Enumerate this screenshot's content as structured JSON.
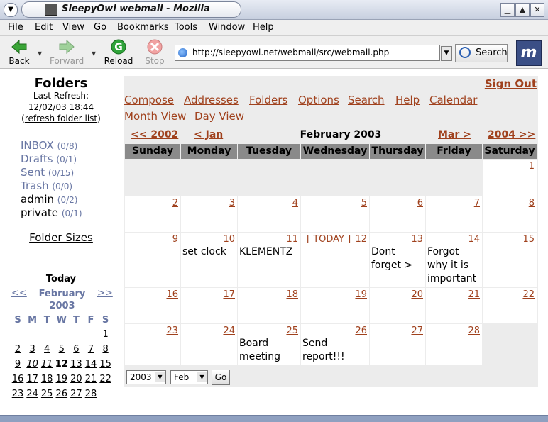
{
  "window": {
    "title": "SleepyOwl webmail - Mozilla"
  },
  "menubar": [
    {
      "label": "File"
    },
    {
      "label": "Edit"
    },
    {
      "label": "View"
    },
    {
      "label": "Go"
    },
    {
      "label": "Bookmarks"
    },
    {
      "label": "Tools"
    },
    {
      "label": "Window"
    },
    {
      "label": "Help"
    }
  ],
  "toolbar": {
    "back": "Back",
    "forward": "Forward",
    "reload": "Reload",
    "stop": "Stop",
    "url": "http://sleepyowl.net/webmail/src/webmail.php",
    "search": "Search"
  },
  "left": {
    "title": "Folders",
    "last_refresh_label": "Last Refresh:",
    "last_refresh_value": "12/02/03 18:44",
    "refresh_link": "refresh folder list",
    "folders": [
      {
        "name": "INBOX",
        "count": "(0/8)"
      },
      {
        "name": "Drafts",
        "count": "(0/1)"
      },
      {
        "name": "Sent",
        "count": "(0/15)"
      },
      {
        "name": "Trash",
        "count": "(0/0)"
      },
      {
        "name": "admin",
        "count": "(0/2)"
      },
      {
        "name": "private",
        "count": "(0/1)"
      }
    ],
    "folder_sizes": "Folder Sizes",
    "mini_cal": {
      "title": "Today",
      "prev": "<<",
      "next": ">>",
      "month": "February",
      "year": "2003",
      "weekdays": [
        "S",
        "M",
        "T",
        "W",
        "T",
        "F",
        "S"
      ],
      "weeks": [
        [
          "",
          "",
          "",
          "",
          "",
          "",
          "1"
        ],
        [
          "2",
          "3",
          "4",
          "5",
          "6",
          "7",
          "8"
        ],
        [
          "9",
          "10",
          "11",
          "12",
          "13",
          "14",
          "15"
        ],
        [
          "16",
          "17",
          "18",
          "19",
          "20",
          "21",
          "22"
        ],
        [
          "23",
          "24",
          "25",
          "26",
          "27",
          "28",
          ""
        ]
      ]
    }
  },
  "right": {
    "signout": "Sign Out",
    "nav": [
      "Compose",
      "Addresses",
      "Folders",
      "Options",
      "Search",
      "Help",
      "Calendar"
    ],
    "views": [
      "Month View",
      "Day View"
    ],
    "calendar": {
      "prev_year": "<< 2002",
      "prev_month": "< Jan",
      "title": "February 2003",
      "next_month": "Mar >",
      "next_year": "2004 >>",
      "weekdays": [
        "Sunday",
        "Monday",
        "Tuesday",
        "Wednesday",
        "Thursday",
        "Friday",
        "Saturday"
      ],
      "today_tag": "[ TODAY ]",
      "weeks": [
        [
          {
            "day": ""
          },
          {
            "day": ""
          },
          {
            "day": ""
          },
          {
            "day": ""
          },
          {
            "day": ""
          },
          {
            "day": ""
          },
          {
            "day": "1"
          }
        ],
        [
          {
            "day": "2"
          },
          {
            "day": "3"
          },
          {
            "day": "4"
          },
          {
            "day": "5"
          },
          {
            "day": "6"
          },
          {
            "day": "7"
          },
          {
            "day": "8"
          }
        ],
        [
          {
            "day": "9"
          },
          {
            "day": "10",
            "event": "set clock"
          },
          {
            "day": "11",
            "event": "KLEMENTZ"
          },
          {
            "day": "12",
            "today": true
          },
          {
            "day": "13",
            "event": "Dont forget >"
          },
          {
            "day": "14",
            "event": "Forgot why it is important"
          },
          {
            "day": "15"
          }
        ],
        [
          {
            "day": "16"
          },
          {
            "day": "17"
          },
          {
            "day": "18"
          },
          {
            "day": "19"
          },
          {
            "day": "20"
          },
          {
            "day": "21"
          },
          {
            "day": "22"
          }
        ],
        [
          {
            "day": "23"
          },
          {
            "day": "24"
          },
          {
            "day": "25",
            "event": "Board meeting"
          },
          {
            "day": "26",
            "event": "Send report!!!"
          },
          {
            "day": "27"
          },
          {
            "day": "28"
          },
          {
            "day": ""
          }
        ]
      ]
    },
    "year_select": "2003",
    "month_select": "Feb",
    "go": "Go"
  }
}
